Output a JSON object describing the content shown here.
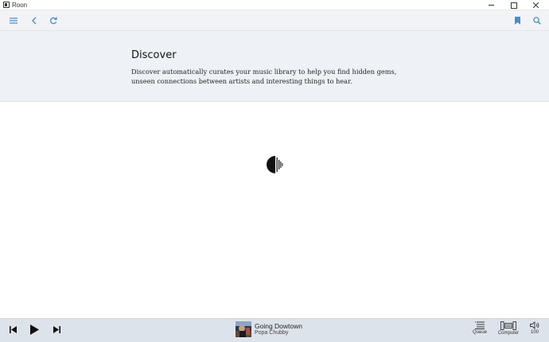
{
  "window": {
    "title": "Roon"
  },
  "header": {
    "heading": "Discover",
    "description": "Discover automatically curates your music library to help you find hidden gems, unseen connections between artists and interesting things to hear."
  },
  "now_playing": {
    "title": "Going Dowtown",
    "artist": "Popa Chubby"
  },
  "controls": {
    "queue_label": "Queue",
    "zone_label": "Computer",
    "volume_value": "100"
  },
  "colors": {
    "accent": "#4a90c8",
    "toolbar_bg": "#f1f3f6",
    "header_bg": "#eef2f6",
    "player_bg": "#dde3ea"
  }
}
